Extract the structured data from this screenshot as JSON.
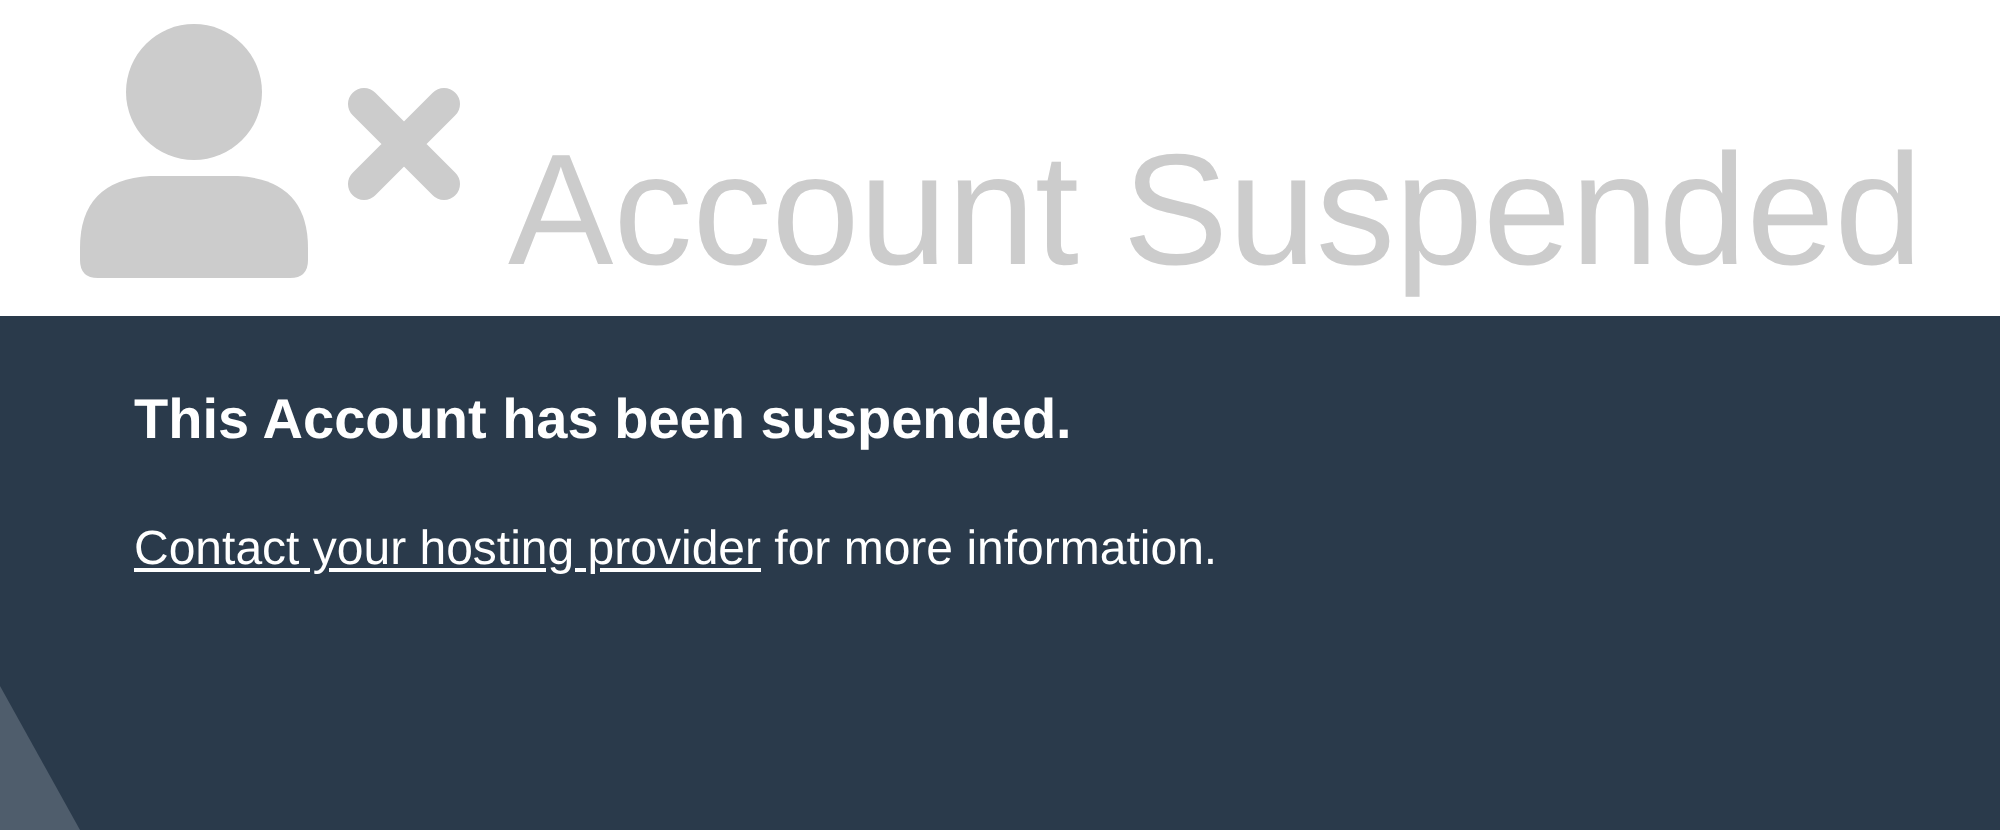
{
  "header": {
    "title": "Account Suspended"
  },
  "message": {
    "heading": "This Account has been suspended.",
    "link": "Contact your hosting provider",
    "text": " for more information."
  }
}
